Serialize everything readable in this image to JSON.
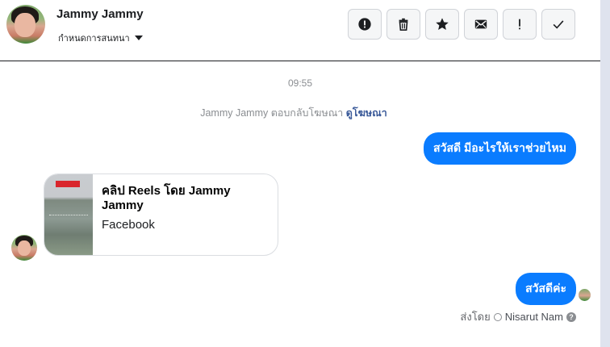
{
  "header": {
    "contact_name": "Jammy Jammy",
    "assign_label": "กำหนดการสนทนา",
    "toolbar": [
      "spam-icon",
      "trash-icon",
      "star-icon",
      "mail-icon",
      "exclamation-icon",
      "check-icon"
    ]
  },
  "thread": {
    "timestamp": "09:55",
    "reply_note": "Jammy Jammy ตอบกลับโฆษณา",
    "reply_note_link": "ดูโฆษณา",
    "message_1": "สวัสดี มีอะไรให้เราช่วยไหม",
    "card_title": "คลิป Reels โดย Jammy Jammy",
    "card_subtitle": "Facebook",
    "message_2": "สวัสดีค่ะ",
    "sent_by_label": "ส่งโดย",
    "sent_by_name": "Nisarut Nam",
    "help_glyph": "?"
  },
  "colors": {
    "bubble": "#0a7cff",
    "link": "#385898",
    "muted": "#8a8d91"
  }
}
